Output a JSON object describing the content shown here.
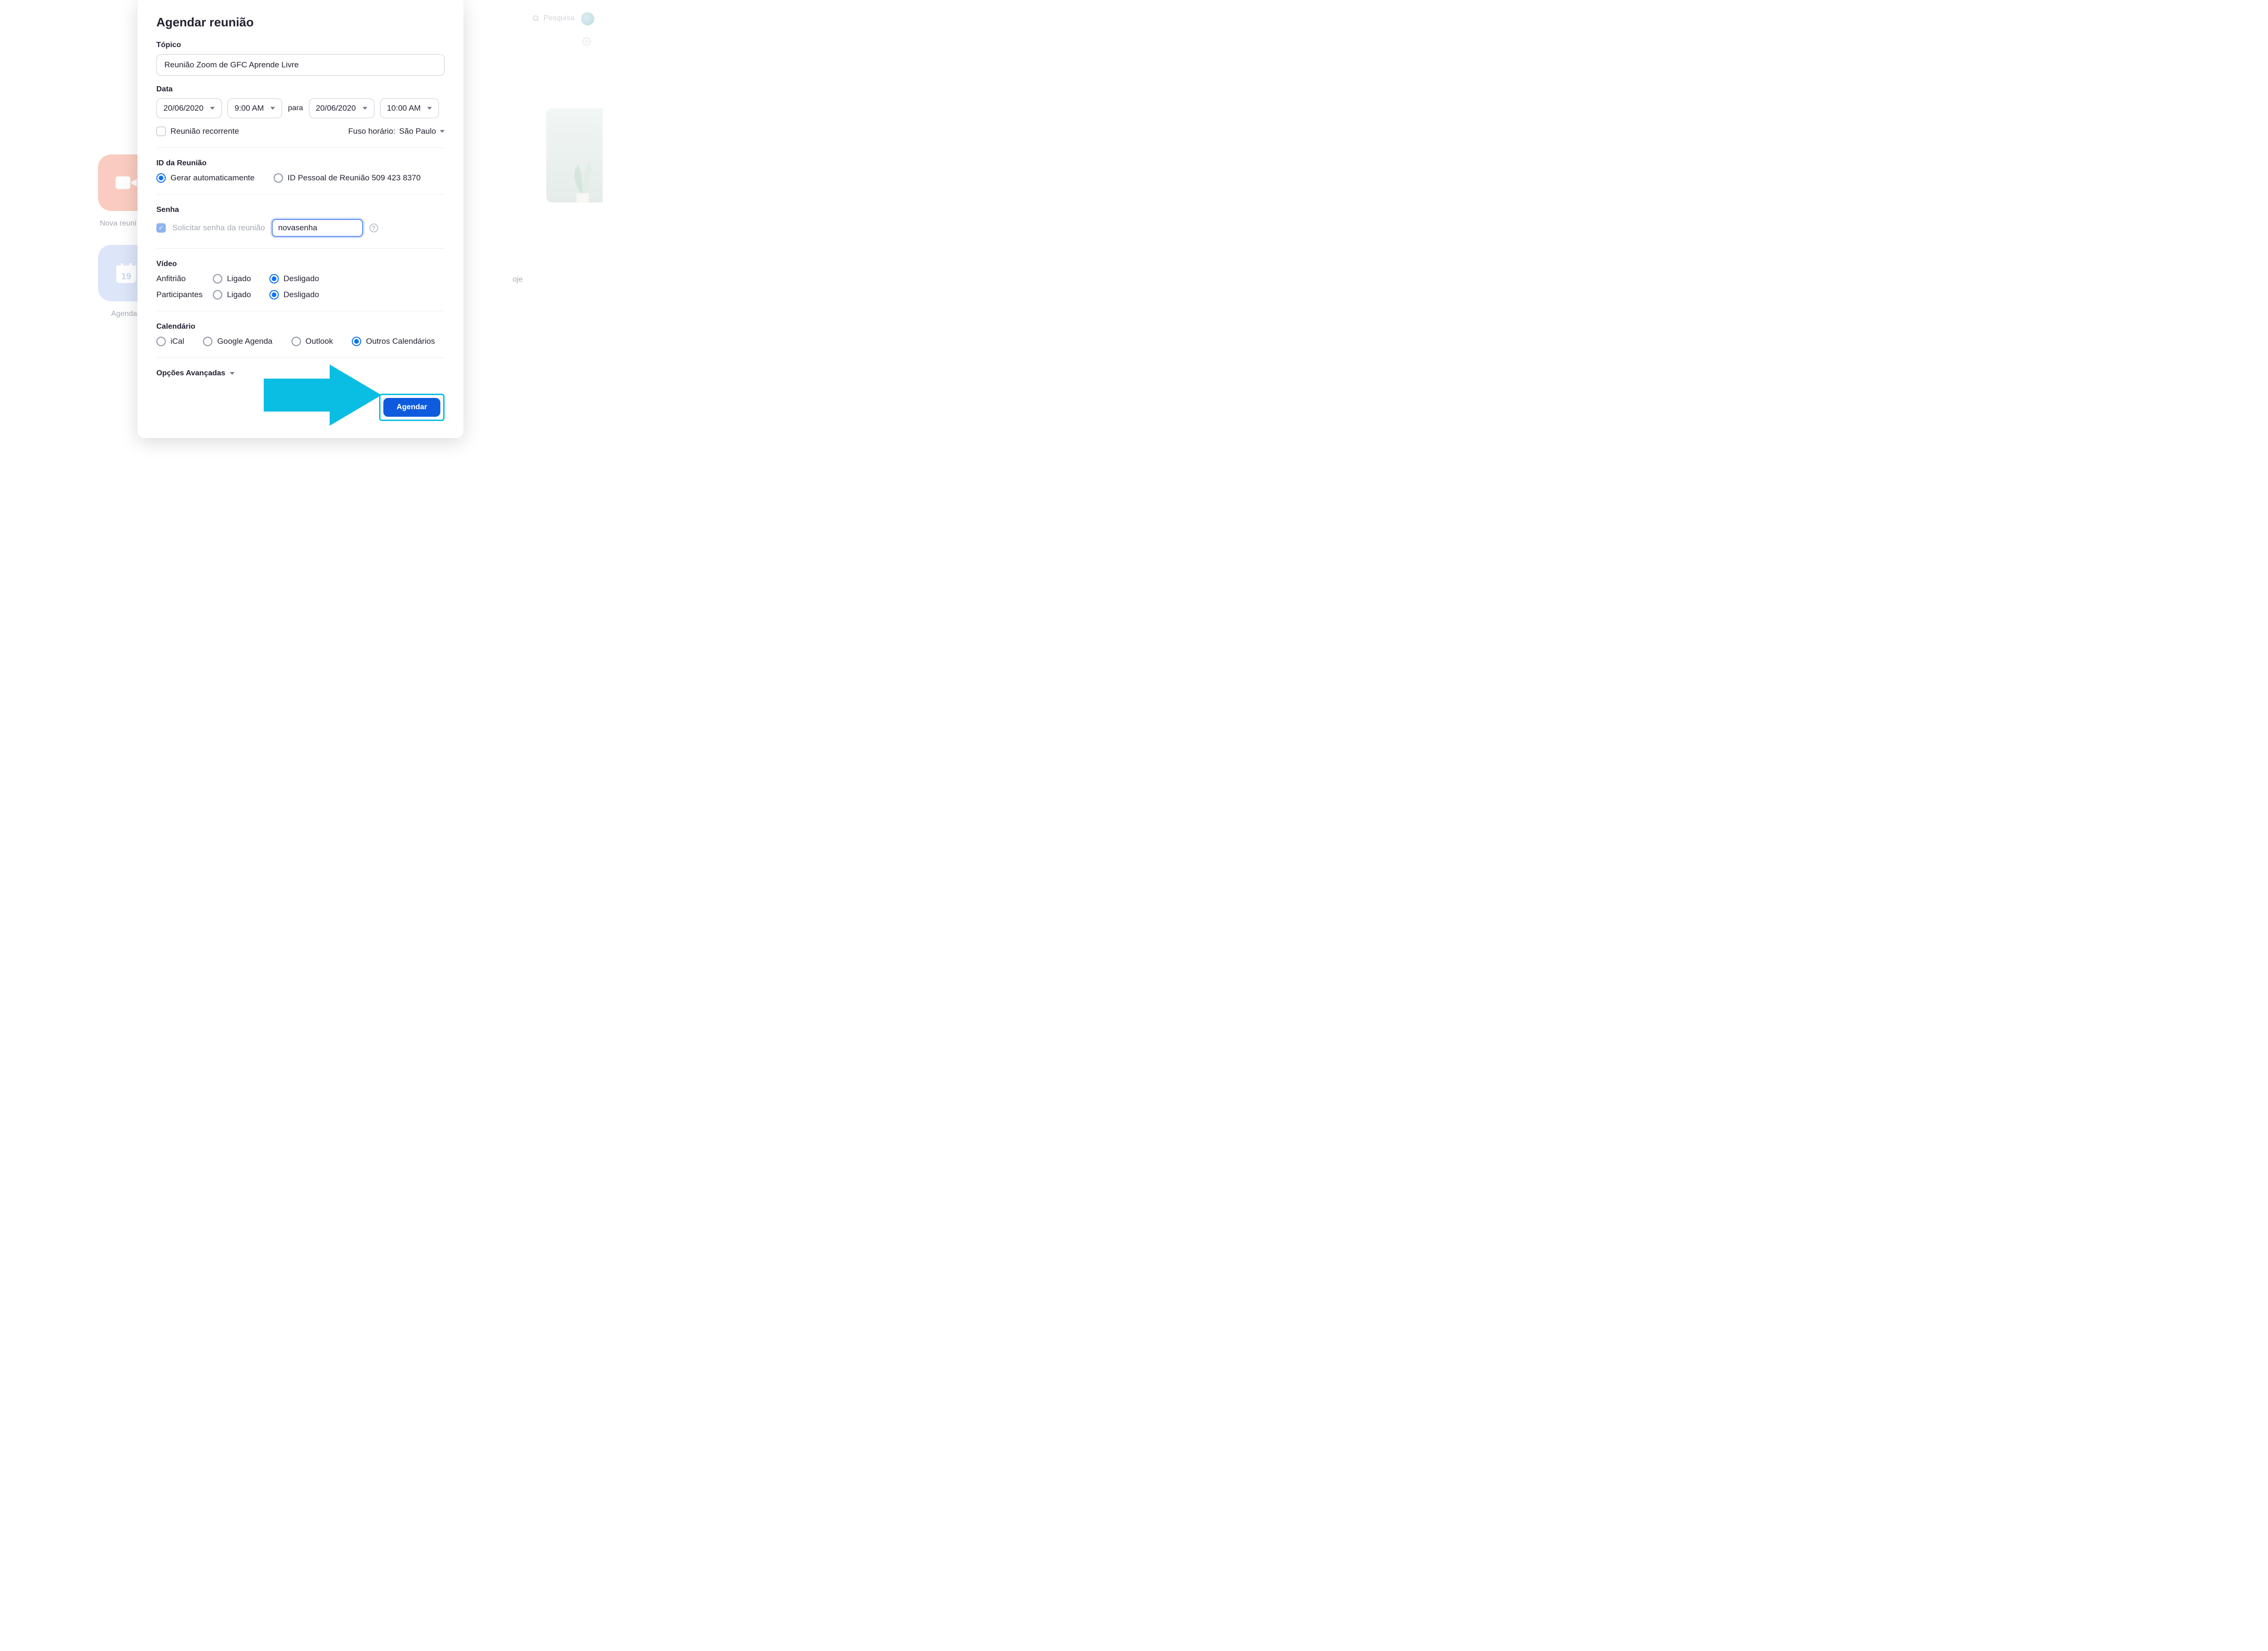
{
  "bg": {
    "search_placeholder": "Pesquisa",
    "new_meeting_label": "Nova reuni",
    "schedule_label": "Agendar",
    "today_label": "oje",
    "calendar_day": "19"
  },
  "modal": {
    "title": "Agendar reunião",
    "topic_label": "Tópico",
    "topic_value": "Reunião Zoom de GFC Aprende Livre",
    "date_label": "Data",
    "start_date": "20/06/2020",
    "start_time": "9:00 AM",
    "para": "para",
    "end_date": "20/06/2020",
    "end_time": "10:00 AM",
    "recurring_label": "Reunião recorrente",
    "tz_label": "Fuso horário:",
    "tz_value": "São Paulo",
    "meeting_id_label": "ID da Reunião",
    "meeting_id_auto": "Gerar automaticamente",
    "meeting_id_personal": "ID Pessoal de Reunião 509 423 8370",
    "password_label": "Senha",
    "password_require": "Solicitar senha da reunião",
    "password_value": "novasenha",
    "video_label": "Vídeo",
    "video_host": "Anfitrião",
    "video_participants": "Participantes",
    "on_label": "Ligado",
    "off_label": "Desligado",
    "calendar_label": "Calendário",
    "cal_ical": "iCal",
    "cal_google": "Google Agenda",
    "cal_outlook": "Outlook",
    "cal_other": "Outros Calendários",
    "advanced_label": "Opções Avançadas",
    "schedule_button": "Agendar"
  }
}
